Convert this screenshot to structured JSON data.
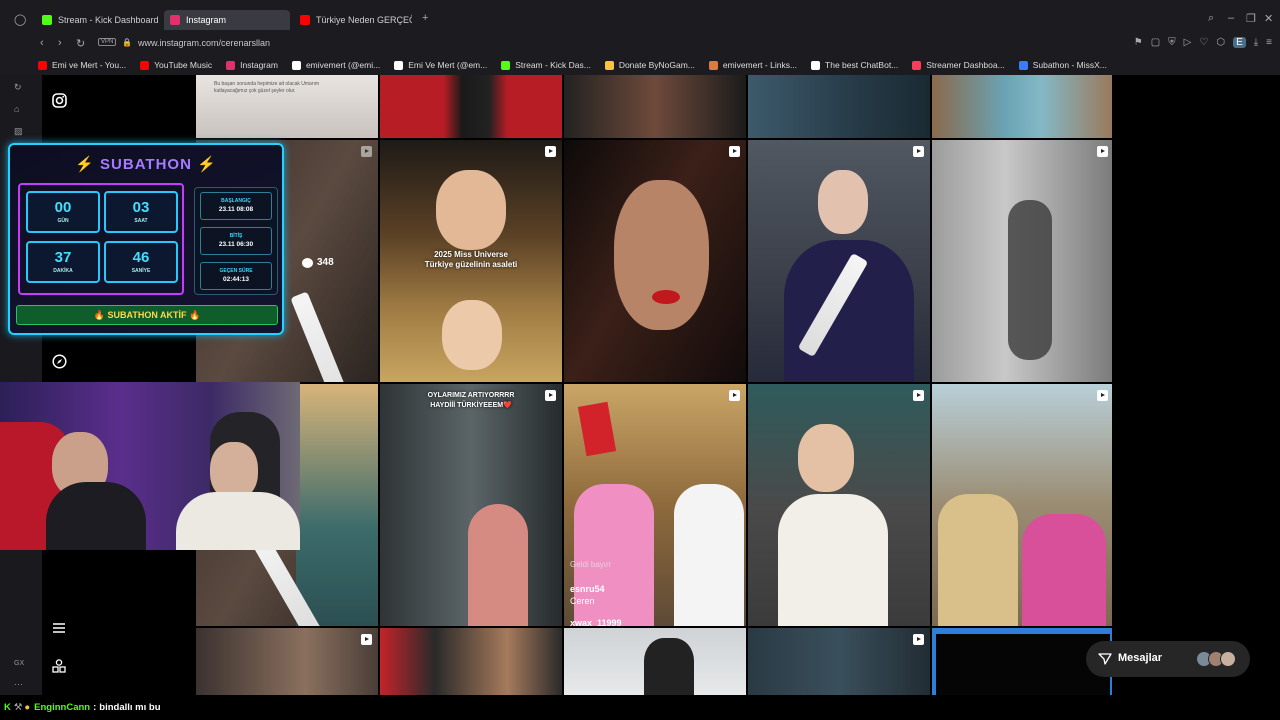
{
  "tabs": [
    {
      "title": "Stream - Kick Dashboard",
      "icon": "kick-icon",
      "color": "#53fc18"
    },
    {
      "title": "Instagram",
      "icon": "instagram-icon",
      "color": "#e1306c"
    },
    {
      "title": "Türkiye Neden GERÇEĞİ",
      "icon": "youtube-icon",
      "color": "#ff0000"
    }
  ],
  "address": {
    "vpn": "VPN",
    "url": "www.instagram.com/cerenarsllan"
  },
  "bookmarks": [
    {
      "label": "Emi ve Mert - You...",
      "icon": "youtube-icon",
      "color": "#ff0000"
    },
    {
      "label": "YouTube Music",
      "icon": "youtube-music-icon",
      "color": "#ff0000"
    },
    {
      "label": "Instagram",
      "icon": "instagram-icon",
      "color": "#e1306c"
    },
    {
      "label": "emivemert (@emi...",
      "icon": "tiktok-icon",
      "color": "#ffffff"
    },
    {
      "label": "Emi Ve Mert (@em...",
      "icon": "x-icon",
      "color": "#ffffff"
    },
    {
      "label": "Stream - Kick Das...",
      "icon": "kick-icon",
      "color": "#53fc18"
    },
    {
      "label": "Donate ByNoGam...",
      "icon": "donate-icon",
      "color": "#f5c542"
    },
    {
      "label": "emivemert - Links...",
      "icon": "linktree-icon",
      "color": "#e07a3b"
    },
    {
      "label": "The best ChatBot...",
      "icon": "chatbot-icon",
      "color": "#ffffff"
    },
    {
      "label": "Streamer Dashboa...",
      "icon": "streamer-icon",
      "color": "#ff3b5c"
    },
    {
      "label": "Subathon - MissX...",
      "icon": "subathon-icon",
      "color": "#3a7bff"
    }
  ],
  "grid": {
    "comment_count": "348",
    "overlays": {
      "caption_top": "Bu başarı sonunda hepimize ait olacak Umarım kutlayacağımız çok güzel şeyler olur.",
      "universe_1": "2025 Miss Universe",
      "universe_2": "Türkiye güzelinin asaleti",
      "cheer_1": "OYLARIMIZ ARTIYORRRR",
      "cheer_2": "HAYDİİİ TÜRKİYEEEM❤️",
      "chat_1": "Geldi bayırr",
      "chat_2_user": "esnru54",
      "chat_2_msg": "Ceren",
      "chat_3": "xwax_11999"
    }
  },
  "subathon": {
    "title": "SUBATHON",
    "timer": [
      {
        "value": "00",
        "label": "GÜN"
      },
      {
        "value": "03",
        "label": "SAAT"
      },
      {
        "value": "37",
        "label": "DAKİKA"
      },
      {
        "value": "46",
        "label": "SANİYE"
      }
    ],
    "info": [
      {
        "key": "BAŞLANGIÇ",
        "value": "23.11 08:08"
      },
      {
        "key": "BİTİŞ",
        "value": "23.11 06:30"
      },
      {
        "key": "GEÇEN SÜRE",
        "value": "02:44:13"
      }
    ],
    "status": "🔥 SUBATHON AKTİF 🔥"
  },
  "messages": {
    "label": "Mesajlar"
  },
  "chat": {
    "user": "EnginnCann",
    "separator": ":",
    "message": "bindallı mı bu"
  },
  "sidebar": {
    "gx_label": "GX",
    "more_label": "···"
  }
}
